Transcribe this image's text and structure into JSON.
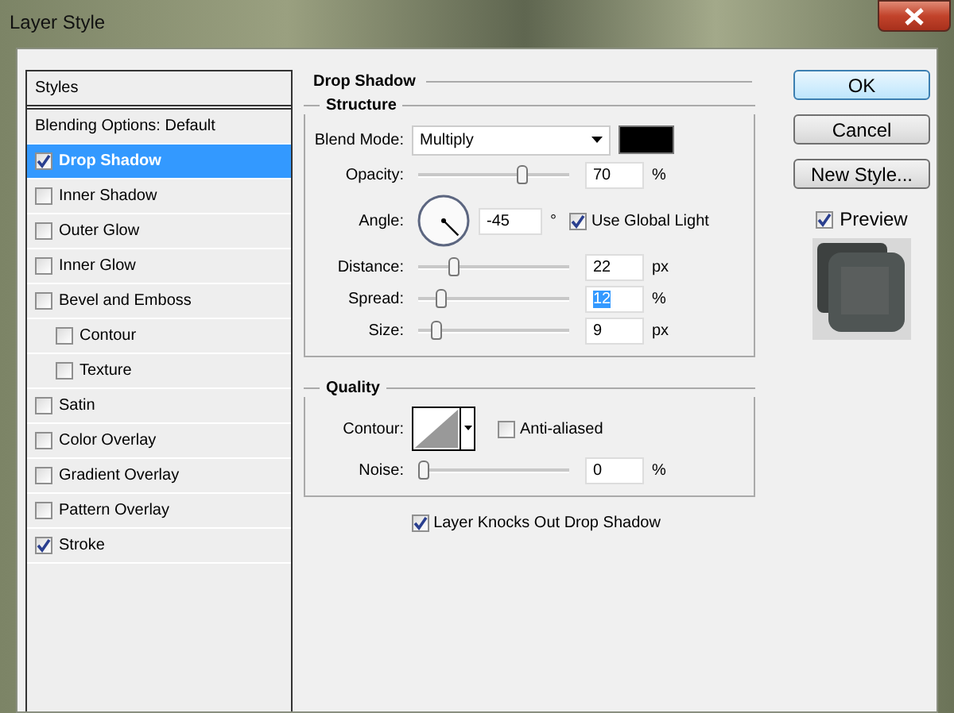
{
  "window": {
    "title": "Layer Style"
  },
  "styles_list": {
    "header": "Styles",
    "items": [
      {
        "kind": "option",
        "label": "Blending Options: Default",
        "selected": false
      },
      {
        "kind": "effect",
        "label": "Drop Shadow",
        "checked": true,
        "selected": true
      },
      {
        "kind": "effect",
        "label": "Inner Shadow",
        "checked": false,
        "selected": false
      },
      {
        "kind": "effect",
        "label": "Outer Glow",
        "checked": false,
        "selected": false
      },
      {
        "kind": "effect",
        "label": "Inner Glow",
        "checked": false,
        "selected": false
      },
      {
        "kind": "effect",
        "label": "Bevel and Emboss",
        "checked": false,
        "selected": false,
        "children": [
          {
            "kind": "effect",
            "label": "Contour",
            "checked": false,
            "selected": false
          },
          {
            "kind": "effect",
            "label": "Texture",
            "checked": false,
            "selected": false
          }
        ]
      },
      {
        "kind": "effect",
        "label": "Satin",
        "checked": false,
        "selected": false
      },
      {
        "kind": "effect",
        "label": "Color Overlay",
        "checked": false,
        "selected": false
      },
      {
        "kind": "effect",
        "label": "Gradient Overlay",
        "checked": false,
        "selected": false
      },
      {
        "kind": "effect",
        "label": "Pattern Overlay",
        "checked": false,
        "selected": false
      },
      {
        "kind": "effect",
        "label": "Stroke",
        "checked": true,
        "selected": false
      }
    ]
  },
  "drop_shadow": {
    "title": "Drop Shadow",
    "structure": {
      "title": "Structure",
      "blend_mode": {
        "label": "Blend Mode:",
        "value": "Multiply"
      },
      "opacity": {
        "label": "Opacity:",
        "level": 0.7,
        "value": "70",
        "unit": "%"
      },
      "angle": {
        "label": "Angle:",
        "value": "-45",
        "unit": "°",
        "use_global_light": {
          "label": "Use Global Light",
          "checked": true
        }
      },
      "distance": {
        "label": "Distance:",
        "level": 0.22,
        "value": "22",
        "unit": "px"
      },
      "spread": {
        "label": "Spread:",
        "level": 0.12,
        "value": "12",
        "unit": "%",
        "text_selected": true
      },
      "size": {
        "label": "Size:",
        "level": 0.09,
        "value": "9",
        "unit": "px"
      }
    },
    "quality": {
      "title": "Quality",
      "contour": {
        "label": "Contour:"
      },
      "anti_aliased": {
        "label": "Anti-aliased",
        "checked": false
      },
      "noise": {
        "label": "Noise:",
        "level": 0,
        "value": "0",
        "unit": "%"
      }
    },
    "layer_knocks_out": {
      "label": "Layer Knocks Out Drop Shadow",
      "checked": true
    }
  },
  "buttons": [
    {
      "label": "OK",
      "default": true
    },
    {
      "label": "Cancel",
      "default": false
    },
    {
      "label": "New Style...",
      "default": false
    }
  ],
  "preview": {
    "label": "Preview",
    "checked": true
  }
}
